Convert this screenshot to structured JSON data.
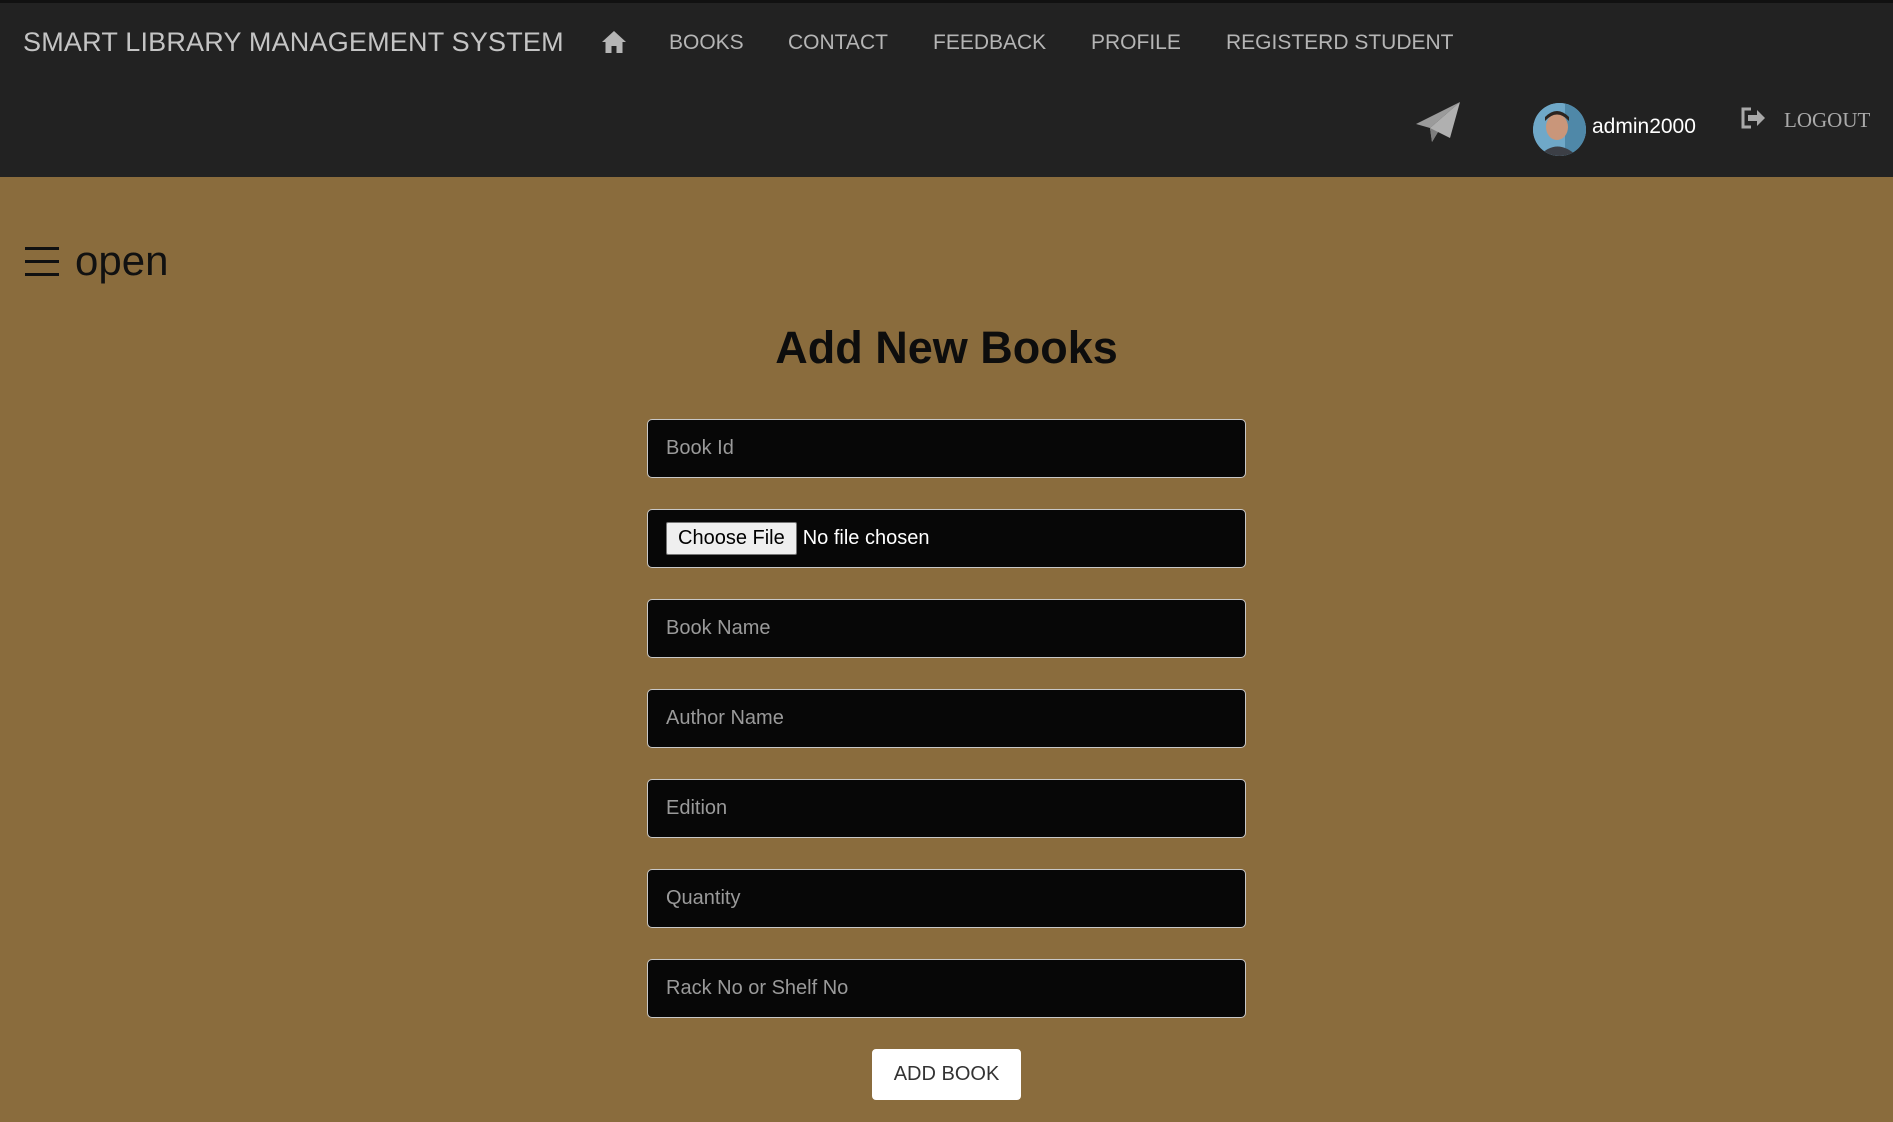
{
  "navbar": {
    "brand": "SMART LIBRARY MANAGEMENT SYSTEM",
    "home_icon": "home-icon",
    "links": [
      "BOOKS",
      "CONTACT",
      "FEEDBACK",
      "PROFILE",
      "REGISTERD STUDENT"
    ],
    "send_icon": "paper-plane-icon",
    "username": "admin2000",
    "logout_icon": "logout-icon",
    "logout_label": "LOGOUT"
  },
  "sidebar_toggle": {
    "icon": "hamburger-icon",
    "label": "open"
  },
  "form": {
    "title": "Add New Books",
    "book_id_placeholder": "Book Id",
    "file_button_label": "Choose File",
    "file_status": "No file chosen",
    "book_name_placeholder": "Book Name",
    "author_name_placeholder": "Author Name",
    "edition_placeholder": "Edition",
    "quantity_placeholder": "Quantity",
    "rack_placeholder": "Rack No or Shelf No",
    "submit_label": "ADD BOOK"
  },
  "colors": {
    "navbar_bg": "#222222",
    "page_bg": "#8a6c3d",
    "input_bg": "#070707",
    "nav_text": "#b5b5b5"
  }
}
